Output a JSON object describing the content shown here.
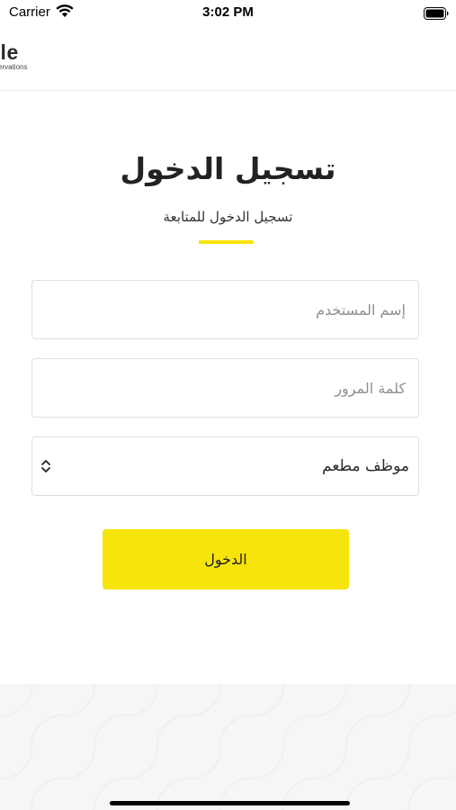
{
  "status_bar": {
    "carrier": "Carrier",
    "time": "3:02 PM"
  },
  "header": {
    "logo_text": "ble",
    "logo_subtext": "servations"
  },
  "login": {
    "title": "تسجيل الدخول",
    "subtitle": "تسجيل الدخول للمتابعة",
    "accent_color": "#f7e40b",
    "username_placeholder": "إسم المستخدم",
    "password_placeholder": "كلمة المرور",
    "role_selected": "موظف مطعم",
    "submit_label": "الدخول"
  }
}
